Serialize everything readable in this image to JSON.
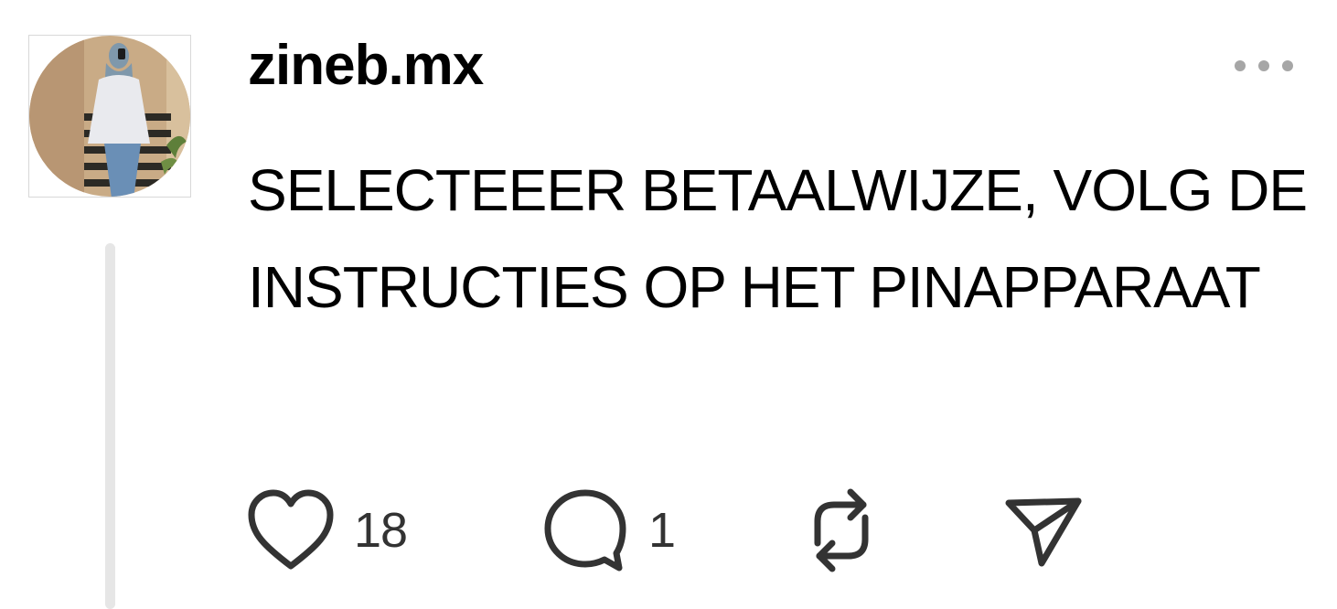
{
  "post": {
    "username": "zineb.mx",
    "text": "SELECTEEER BETAALWIJZE, VOLG DE INSTRUCTIES OP HET PINAPPARAAT"
  },
  "actions": {
    "like_count": "18",
    "reply_count": "1"
  },
  "icons": {
    "more": "more-horizontal-icon",
    "like": "heart-icon",
    "reply": "comment-bubble-icon",
    "repost": "repost-icon",
    "share": "send-icon"
  },
  "colors": {
    "text": "#000000",
    "icon": "#333333",
    "thread_line": "#e6e6e6",
    "more_dots": "#a6a6a6"
  }
}
